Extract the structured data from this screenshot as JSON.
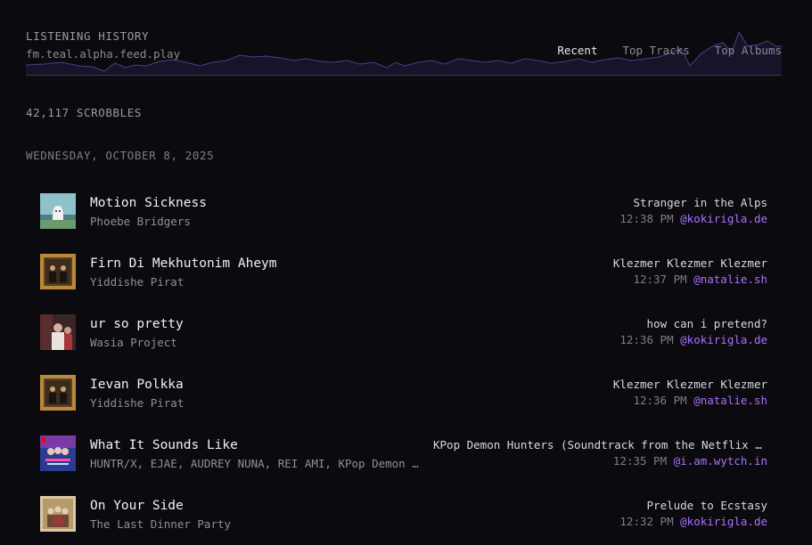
{
  "header": {
    "title": "LISTENING HISTORY",
    "subtitle": "fm.teal.alpha.feed.play",
    "tabs": [
      {
        "label": "Recent",
        "active": true
      },
      {
        "label": "Top Tracks",
        "active": false
      },
      {
        "label": "Top Albums",
        "active": false
      }
    ]
  },
  "scrobble_count": "42,117 SCROBBLES",
  "date_heading": "WEDNESDAY, OCTOBER 8, 2025",
  "colors": {
    "background": "#0b0b0f",
    "accent": "#a970ff"
  },
  "plays": [
    {
      "track": "Motion Sickness",
      "artist": "Phoebe Bridgers",
      "album": "Stranger in the Alps",
      "time": "12:38 PM",
      "user": "@kokirigla.de",
      "art_icon": "album-art-stranger-in-the-alps"
    },
    {
      "track": "Firn Di Mekhutonim Aheym",
      "artist": "Yiddishe Pirat",
      "album": "Klezmer Klezmer Klezmer",
      "time": "12:37 PM",
      "user": "@natalie.sh",
      "art_icon": "album-art-klezmer"
    },
    {
      "track": "ur so pretty",
      "artist": "Wasia Project",
      "album": "how can i pretend?",
      "time": "12:36 PM",
      "user": "@kokirigla.de",
      "art_icon": "album-art-how-can-i-pretend"
    },
    {
      "track": "Ievan Polkka",
      "artist": "Yiddishe Pirat",
      "album": "Klezmer Klezmer Klezmer",
      "time": "12:36 PM",
      "user": "@natalie.sh",
      "art_icon": "album-art-klezmer"
    },
    {
      "track": "What It Sounds Like",
      "artist": "HUNTR/X, EJAE, AUDREY NUNA, REI AMI, KPop Demon Hunters Cast",
      "album": "KPop Demon Hunters (Soundtrack from the Netflix Film)",
      "time": "12:35 PM",
      "user": "@i.am.wytch.in",
      "art_icon": "album-art-kpop-demon-hunters"
    },
    {
      "track": "On Your Side",
      "artist": "The Last Dinner Party",
      "album": "Prelude to Ecstasy",
      "time": "12:32 PM",
      "user": "@kokirigla.de",
      "art_icon": "album-art-prelude-to-ecstasy"
    }
  ]
}
